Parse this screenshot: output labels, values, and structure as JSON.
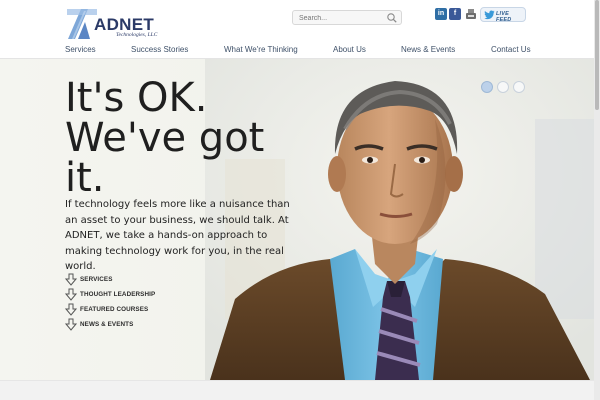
{
  "brand": {
    "name": "ADNET",
    "tagline": "Technologies, LLC"
  },
  "search": {
    "placeholder": "Search..."
  },
  "social": {
    "linkedin": "in",
    "facebook": "f",
    "live_feed": "LIVE FEED"
  },
  "nav": {
    "items": [
      "Services",
      "Success Stories",
      "What We're Thinking",
      "About Us",
      "News & Events",
      "Contact Us"
    ]
  },
  "hero": {
    "headline_lines": [
      "It's OK.",
      "We've got",
      "it."
    ],
    "intro": "If technology feels more like a nuisance than an asset to your business, we should talk. At ADNET, we take a hands-on approach to making technology work for you, in the real world.",
    "quick_links": [
      "SERVICES",
      "THOUGHT LEADERSHIP",
      "FEATURED COURSES",
      "NEWS & EVENTS"
    ],
    "slides": 3,
    "active_slide": 1
  },
  "colors": {
    "brand_navy": "#2b3a67",
    "nav_text": "#3f5169",
    "shirt_blue": "#6fb8dc",
    "slide_active": "#bcd1ea"
  }
}
